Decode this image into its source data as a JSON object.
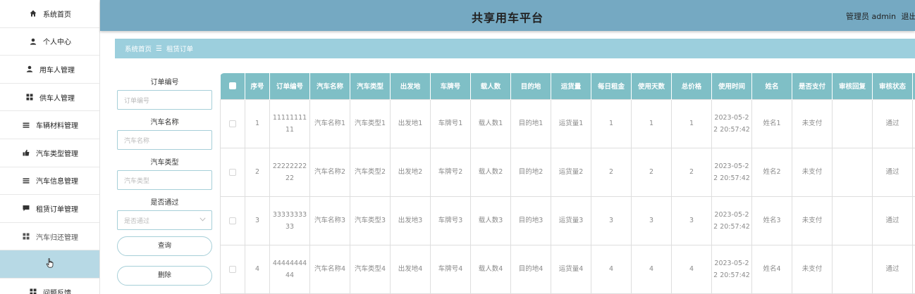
{
  "header": {
    "title": "共享用车平台",
    "admin_text": "管理员 admin",
    "logout": "退出"
  },
  "sidebar": {
    "items": [
      {
        "label": "系统首页",
        "icon": "home-icon"
      },
      {
        "label": "个人中心",
        "icon": "user-icon"
      },
      {
        "label": "用车人管理",
        "icon": "user-icon"
      },
      {
        "label": "供车人管理",
        "icon": "grid-icon"
      },
      {
        "label": "车辆材料管理",
        "icon": "list-icon"
      },
      {
        "label": "汽车类型管理",
        "icon": "thumb-icon"
      },
      {
        "label": "汽车信息管理",
        "icon": "list-icon"
      },
      {
        "label": "租赁订单管理",
        "icon": "chat-icon"
      },
      {
        "label": "汽车归还管理",
        "icon": "grid-icon"
      },
      {
        "label": "",
        "icon": "cursor-icon"
      },
      {
        "label": "问题反馈",
        "icon": "grid-icon"
      }
    ]
  },
  "breadcrumb": {
    "home": "系统首页",
    "separator": "☰",
    "current": "租赁订单"
  },
  "search": {
    "order_no_label": "订单编号",
    "order_no_placeholder": "订单编号",
    "car_name_label": "汽车名称",
    "car_name_placeholder": "汽车名称",
    "car_type_label": "汽车类型",
    "car_type_placeholder": "汽车类型",
    "pass_label": "是否通过",
    "pass_placeholder": "是否通过",
    "query_button": "查询",
    "delete_button": "删除"
  },
  "table": {
    "columns": [
      "序号",
      "订单编号",
      "汽车名称",
      "汽车类型",
      "出发地",
      "车牌号",
      "载人数",
      "目的地",
      "运货量",
      "每日租金",
      "使用天数",
      "总价格",
      "使用时间",
      "姓名",
      "是否支付",
      "审核回复",
      "审核状态"
    ],
    "rows": [
      [
        "1",
        "1111111111",
        "汽车名称1",
        "汽车类型1",
        "出发地1",
        "车牌号1",
        "载人数1",
        "目的地1",
        "运货量1",
        "1",
        "1",
        "1",
        "2023-05-22 20:57:42",
        "姓名1",
        "未支付",
        "",
        "通过"
      ],
      [
        "2",
        "2222222222",
        "汽车名称2",
        "汽车类型2",
        "出发地2",
        "车牌号2",
        "载人数2",
        "目的地2",
        "运货量2",
        "2",
        "2",
        "2",
        "2023-05-22 20:57:42",
        "姓名2",
        "未支付",
        "",
        "通过"
      ],
      [
        "3",
        "3333333333",
        "汽车名称3",
        "汽车类型3",
        "出发地3",
        "车牌号3",
        "载人数3",
        "目的地3",
        "运货量3",
        "3",
        "3",
        "3",
        "2023-05-22 20:57:42",
        "姓名3",
        "未支付",
        "",
        "通过"
      ],
      [
        "4",
        "4444444444",
        "汽车名称4",
        "汽车类型4",
        "出发地4",
        "车牌号4",
        "载人数4",
        "目的地4",
        "运货量4",
        "4",
        "4",
        "4",
        "2023-05-22 20:57:42",
        "姓名4",
        "未支付",
        "",
        "通过"
      ]
    ]
  },
  "colors": {
    "header_bg": "#75a9c2",
    "breadcrumb_bg": "#9ccfdd",
    "table_header_bg": "#7fbfc6",
    "sidebar_active_bg": "#b7d9e5"
  }
}
